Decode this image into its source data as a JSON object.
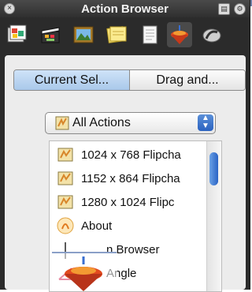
{
  "window": {
    "title": "Action Browser",
    "close_glyph": "×",
    "zoom_glyph": "▤",
    "gear_glyph": "⚙"
  },
  "toolbar": {
    "icons": [
      "clipboard-gallery-icon",
      "film-clapper-icon",
      "photo-frame-icon",
      "sticky-notes-icon",
      "document-icon",
      "spinning-top-icon",
      "eraser-icon"
    ]
  },
  "tabs": {
    "current_selection": "Current Sel...",
    "drag_and": "Drag and..."
  },
  "filter": {
    "selected": "All Actions",
    "arrows_glyph": "⬍"
  },
  "actions": [
    {
      "label": "1024 x 768 Flipcha",
      "icon": "flipchart-icon"
    },
    {
      "label": "1152 x 864 Flipcha",
      "icon": "flipchart-icon"
    },
    {
      "label": "1280 x 1024 Flipc",
      "icon": "flipchart-icon"
    },
    {
      "label": "About",
      "icon": "about-icon"
    },
    {
      "label": "n Browser",
      "icon": "action-browser-icon"
    },
    {
      "label": "Angle",
      "icon": "angle-icon"
    }
  ],
  "colors": {
    "palette_bg": "#2b2b2b",
    "content_bg": "#ececec",
    "selection_blue": "#a9c8ea",
    "scroll_thumb": "#2a63c4"
  }
}
